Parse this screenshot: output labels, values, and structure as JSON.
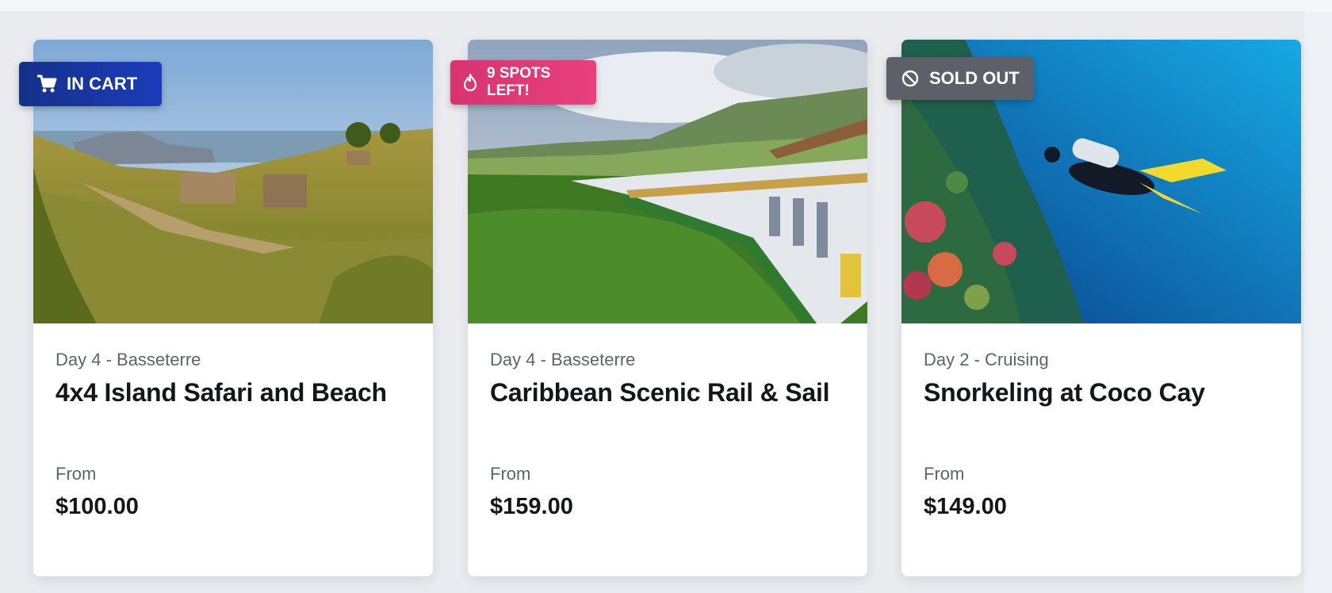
{
  "cards": [
    {
      "badge": {
        "label": "IN CART",
        "icon": "cart-icon",
        "color": "#1c3dbb"
      },
      "day": "Day 4 - Basseterre",
      "title": "4x4 Island Safari and Beach",
      "from_label": "From",
      "price": "$100.00"
    },
    {
      "badge": {
        "label": "9 SPOTS LEFT!",
        "icon": "flame-icon",
        "color": "#e8407c"
      },
      "day": "Day 4 - Basseterre",
      "title": "Caribbean Scenic Rail & Sail",
      "from_label": "From",
      "price": "$159.00"
    },
    {
      "badge": {
        "label": "SOLD OUT",
        "icon": "ban-icon",
        "color": "#5d6069"
      },
      "day": "Day 2 - Cruising",
      "title": "Snorkeling at Coco Cay",
      "from_label": "From",
      "price": "$149.00"
    }
  ]
}
